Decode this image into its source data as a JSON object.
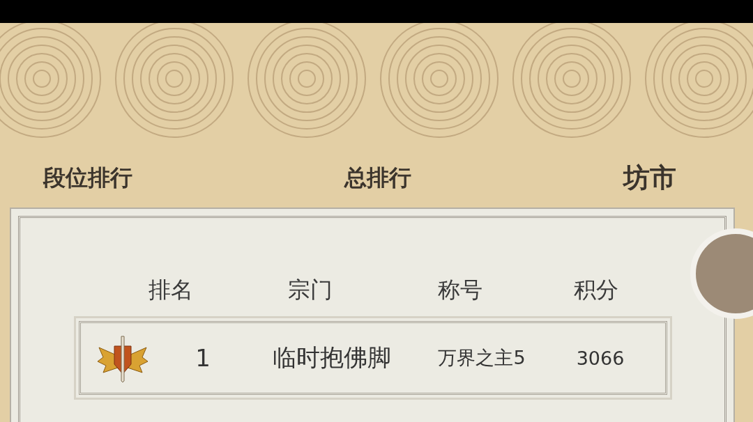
{
  "tabs": [
    {
      "label": "段位排行",
      "selected": false
    },
    {
      "label": "总排行",
      "selected": false
    },
    {
      "label": "坊市",
      "selected": false
    }
  ],
  "table": {
    "columns": [
      "排名",
      "宗门",
      "称号",
      "积分"
    ],
    "rows": [
      {
        "rank": "1",
        "sect": "临时抱佛脚",
        "title": "万界之主5",
        "score": "3066"
      }
    ]
  }
}
